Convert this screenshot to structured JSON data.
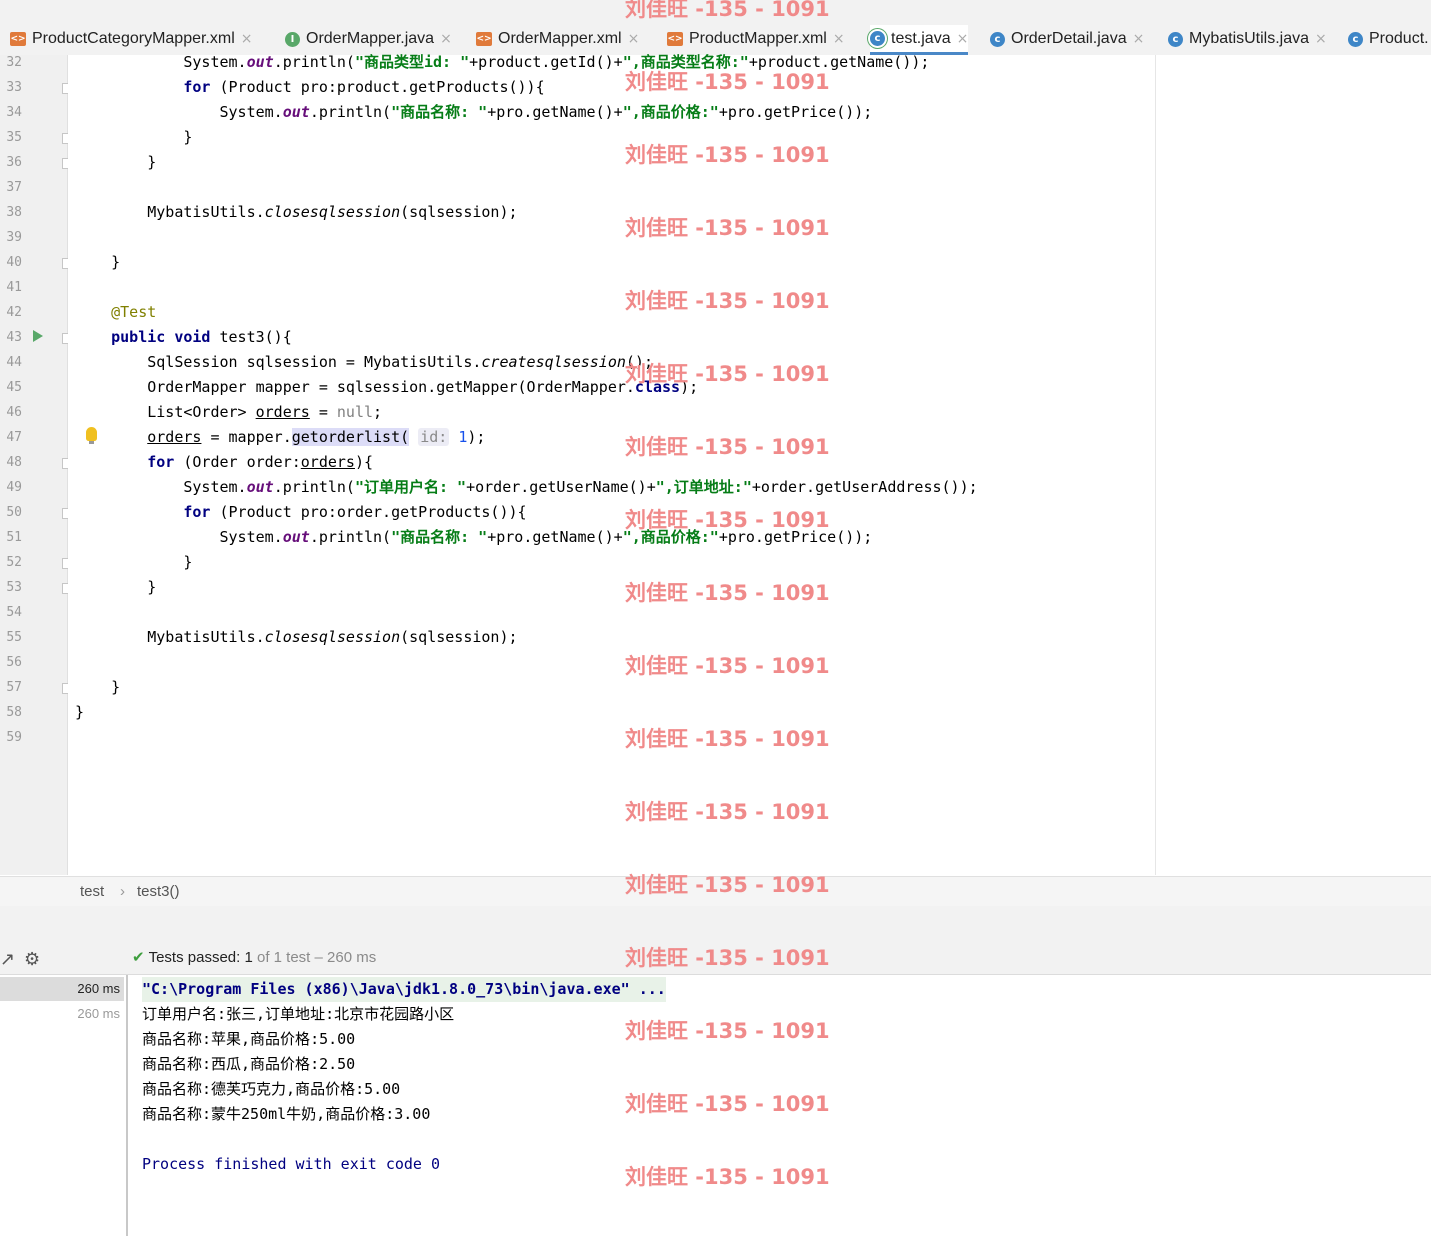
{
  "tabs": [
    {
      "label": "ProductCategoryMapper.xml",
      "type": "xml",
      "close": "×"
    },
    {
      "label": "OrderMapper.java",
      "type": "iface",
      "close": "×"
    },
    {
      "label": "OrderMapper.xml",
      "type": "xml",
      "close": "×"
    },
    {
      "label": "ProductMapper.xml",
      "type": "xml",
      "close": "×"
    },
    {
      "label": "test.java",
      "type": "test",
      "close": "×",
      "active": true
    },
    {
      "label": "OrderDetail.java",
      "type": "cls",
      "close": "×"
    },
    {
      "label": "MybatisUtils.java",
      "type": "cls",
      "close": "×"
    },
    {
      "label": "Product.",
      "type": "cls",
      "close": ""
    }
  ],
  "code_lines": [
    {
      "n": "32",
      "html": "            System.<span class='fi'>out</span>.println(<span class='st'>\"商品类型id: \"</span>+product.getId()+<span class='st'>\",商品类型名称:\"</span>+product.getName());"
    },
    {
      "n": "33",
      "html": "            <span class='kw'>for</span> (Product pro:product.getProducts()){"
    },
    {
      "n": "34",
      "html": "                System.<span class='fi'>out</span>.println(<span class='st'>\"商品名称: \"</span>+pro.getName()+<span class='st'>\",商品价格:\"</span>+pro.getPrice());"
    },
    {
      "n": "35",
      "html": "            }"
    },
    {
      "n": "36",
      "html": "        }"
    },
    {
      "n": "37",
      "html": ""
    },
    {
      "n": "38",
      "html": "        MybatisUtils.<span class='it'>closesqlsession</span>(sqlsession);"
    },
    {
      "n": "39",
      "html": ""
    },
    {
      "n": "40",
      "html": "    }"
    },
    {
      "n": "41",
      "html": ""
    },
    {
      "n": "42",
      "html": "    <span class='an'>@Test</span>"
    },
    {
      "n": "43",
      "html": "    <span class='kw'>public void</span> test3(){"
    },
    {
      "n": "44",
      "html": "        SqlSession sqlsession = MybatisUtils.<span class='it'>createsqlsession</span>();"
    },
    {
      "n": "45",
      "html": "        OrderMapper mapper = sqlsession.getMapper(OrderMapper.<span class='kw'>class</span>);"
    },
    {
      "n": "46",
      "html": "        List&lt;Order&gt; <span class='ul'>orders</span> = <span class='nl'>null</span>;"
    },
    {
      "n": "47",
      "html": "        <span class='ul'>orders</span> = mapper.<span class='selm'>getorderlist(</span> <span class='hint'>id:</span> <span class='num'>1</span>);"
    },
    {
      "n": "48",
      "html": "        <span class='kw'>for</span> (Order order:<span class='ul'>orders</span>){"
    },
    {
      "n": "49",
      "html": "            System.<span class='fi'>out</span>.println(<span class='st'>\"订单用户名: \"</span>+order.getUserName()+<span class='st'>\",订单地址:\"</span>+order.getUserAddress());"
    },
    {
      "n": "50",
      "html": "            <span class='kw'>for</span> (Product pro:order.getProducts()){"
    },
    {
      "n": "51",
      "html": "                System.<span class='fi'>out</span>.println(<span class='st'>\"商品名称: \"</span>+pro.getName()+<span class='st'>\",商品价格:\"</span>+pro.getPrice());"
    },
    {
      "n": "52",
      "html": "            }"
    },
    {
      "n": "53",
      "html": "        }"
    },
    {
      "n": "54",
      "html": ""
    },
    {
      "n": "55",
      "html": "        MybatisUtils.<span class='it'>closesqlsession</span>(sqlsession);"
    },
    {
      "n": "56",
      "html": ""
    },
    {
      "n": "57",
      "html": "    }"
    },
    {
      "n": "58",
      "html": "}"
    },
    {
      "n": "59",
      "html": ""
    }
  ],
  "folds": [
    "33",
    "35",
    "36",
    "40",
    "43",
    "48",
    "50",
    "52",
    "53",
    "57"
  ],
  "breadcrumb": {
    "item1": "test",
    "sep": "›",
    "item2": "test3()"
  },
  "run": {
    "passed_label": "Tests passed:",
    "passed_count": "1",
    "passed_rest": "of 1 test – 260 ms",
    "tree": [
      {
        "label": "260 ms",
        "selected": true
      },
      {
        "label": "260 ms",
        "selected": false
      }
    ],
    "console": [
      {
        "text": "\"C:\\Program Files (x86)\\Java\\jdk1.8.0_73\\bin\\java.exe\" ...",
        "kind": "cmd"
      },
      {
        "text": "订单用户名:张三,订单地址:北京市花园路小区",
        "kind": "out"
      },
      {
        "text": "商品名称:苹果,商品价格:5.00",
        "kind": "out"
      },
      {
        "text": "商品名称:西瓜,商品价格:2.50",
        "kind": "out"
      },
      {
        "text": "商品名称:德芙巧克力,商品价格:5.00",
        "kind": "out"
      },
      {
        "text": "商品名称:蒙牛250ml牛奶,商品价格:3.00",
        "kind": "out"
      },
      {
        "text": "",
        "kind": "out"
      },
      {
        "text": "Process finished with exit code 0",
        "kind": "proc"
      }
    ]
  },
  "watermark": "刘佳旺 -135 - 1091",
  "watermark_count": 17,
  "colors": {
    "accent": "#4a88c7",
    "string": "#067d17",
    "keyword": "#000080",
    "watermark": "#f08a8a"
  }
}
